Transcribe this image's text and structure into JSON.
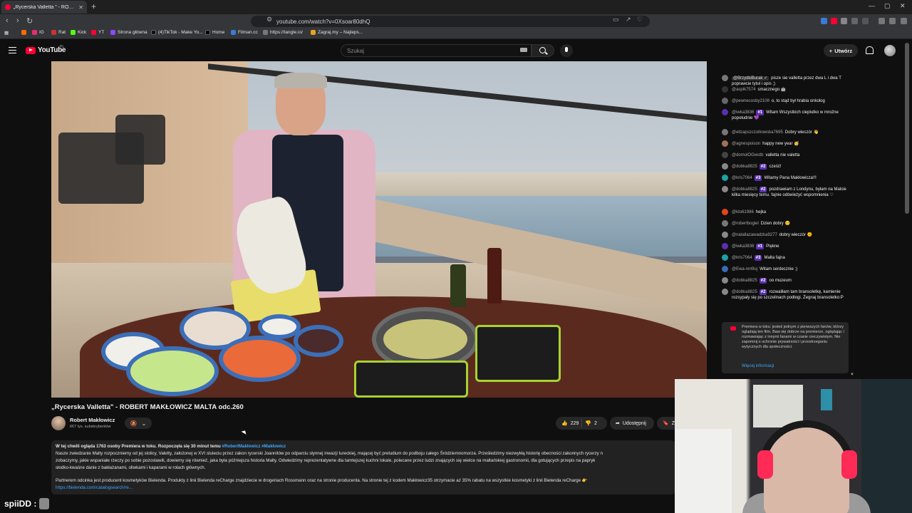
{
  "browser": {
    "tab_title": "„Rycerska Valletta \" - ROBERT",
    "url": "youtube.com/watch?v=0Xsoar80dhQ",
    "new_tab_symbol": "+",
    "tab_close_symbol": "✕",
    "bookmarks": [
      {
        "label": "IG",
        "color": "#e1306c"
      },
      {
        "label": "Rat",
        "color": "#cc3333"
      },
      {
        "label": "Kick",
        "color": "#53fc18"
      },
      {
        "label": "YT",
        "color": "#ff0033"
      },
      {
        "label": "Strona główna",
        "color": "#9146ff"
      },
      {
        "label": "(4)TikTok - Make Yo...",
        "color": "#111111"
      },
      {
        "label": "Home",
        "color": "#000000"
      },
      {
        "label": "Filman.cc",
        "color": "#3a7bd5"
      },
      {
        "label": "https://tangle.io/",
        "color": "#777777"
      },
      {
        "label": "Zagraj.my – Najleps...",
        "color": "#e8a320"
      }
    ]
  },
  "masthead": {
    "logo": "YouTube",
    "region": "PL",
    "search_placeholder": "Szukaj",
    "create_label": "Utwórz",
    "create_icon": "+"
  },
  "video": {
    "title": "„Rycerska Valletta\" - ROBERT MAKŁOWICZ MALTA odc.260",
    "channel": "Robert Makłowicz",
    "subscribers": "667 tys. subskrybentów",
    "notify_icon": "bell-slash-icon",
    "likes": "229",
    "dislikes": "2",
    "share_label": "Udostępnij",
    "save_label": "Za"
  },
  "description": {
    "meta": "W tej chwili ogląda 1763 osoby  Premiera w toku. Rozpoczęła się 30 minut temu",
    "tags": "#RobertMakłowicz #Makłowicz",
    "line1": "Nasze zwiedzanie Malty rozpoczniemy od jej stolicy, Valetty, założonej w XVI stuleciu przez zakon rycerski Joannitów po odparciu słynnej inwazji tureckiej, mającej być preludium do podboju całego Śródziemnomorza. Prześledzimy niezwykłą historię obecności zakonnych rycerzy n",
    "line2": "zobaczymy, jakie wspaniałe rzeczy po sobie pozostawili, dowiemy się również, jaka była późniejsza historia Malty. Odwiedzimy reprezentatywne dla tamtejszej kuchni lokale, polecane przez ludzi znających się wielce na maltańskiej gastronomii, dla gotujących przepis na papryk",
    "line3": "słodko-kwaśne danie z bakłażanami, oliwkami i kaparami w rolach głównych.",
    "line4": "Partnerem odcinka jest producent kosmetyków Bielenda. Produkty z linii Bielenda reCharge znajdziecie w drogeriach Rossmann oraz na stronie producenta. Na stronie tej z kodem Makłowicz35 otrzymacie aż 35% rabatu na wszystkie kosmetyki z linii Bielenda reCharge 👉",
    "link": "https://bielenda.com/catalogsearch/re..."
  },
  "chat": {
    "messages": [
      {
        "author": "@BrzydkiBurak ✓",
        "badge": "",
        "text": "pisze sie valletta przez dwa L i dwa T poprawcie tytuł i opis ;)",
        "color": "#777777",
        "highlight": true
      },
      {
        "author": "@aspik7574",
        "badge": "",
        "text": "smacznego 🤖",
        "color": "#333333",
        "highlight": false
      },
      {
        "author": "@pewnecosby2108",
        "badge": "",
        "text": "o, to stąd był hrabia onkolog",
        "color": "#666666",
        "highlight": false
      },
      {
        "author": "@iwka3836",
        "badge": "#1",
        "text": "Witam Wszystkich cieplutko w mroźne popołudnie 💜",
        "color": "#5a2fb0",
        "highlight": false
      },
      {
        "author": "@elizapszczolkowska7695",
        "badge": "",
        "text": "Dobry wieczór 👋",
        "color": "#777777",
        "highlight": false
      },
      {
        "author": "@agnespoison",
        "badge": "",
        "text": "happy new year 🥳",
        "color": "#a0705a",
        "highlight": false
      },
      {
        "author": "@domolOGwotb",
        "badge": "",
        "text": "valletta nie valetta",
        "color": "#444444",
        "highlight": false
      },
      {
        "author": "@dobka8825",
        "badge": "#2",
        "text": "cześć!",
        "color": "#888888",
        "highlight": false
      },
      {
        "author": "@kris7064",
        "badge": "#3",
        "text": "Witamy Pana Makłowicza!!!",
        "color": "#1aa3a3",
        "highlight": false
      },
      {
        "author": "@dobka8825",
        "badge": "#2",
        "text": "pozdrawiam z Londynu, byłam na Malcie kilka miesięcy temu. fajnie odświeżyć wspomnienia ♡",
        "color": "#888888",
        "highlight": false
      },
      {
        "author": "@kto61986",
        "badge": "",
        "text": "hejka",
        "color": "#e0451f",
        "highlight": false
      },
      {
        "author": "@robertbogiel",
        "badge": "",
        "text": "Dzien dobry 😊",
        "color": "#777777",
        "highlight": false
      },
      {
        "author": "@natallazawadzka9277",
        "badge": "",
        "text": "dobry wieczór 🌞",
        "color": "#888888",
        "highlight": false
      },
      {
        "author": "@iwka3836",
        "badge": "#1",
        "text": "Piękne",
        "color": "#5a2fb0",
        "highlight": false
      },
      {
        "author": "@kris7064",
        "badge": "#3",
        "text": "Malta fajna",
        "color": "#1aa3a3",
        "highlight": false
      },
      {
        "author": "@Ewa-nm9uj",
        "badge": "",
        "text": "Witam serdecznie :)",
        "color": "#3a6ab5",
        "highlight": false
      },
      {
        "author": "@dobka8825",
        "badge": "#2",
        "text": "oo muzeum",
        "color": "#888888",
        "highlight": false
      },
      {
        "author": "@dobka8825",
        "badge": "#2",
        "text": "rozwaliłam tam bransoletkę, kamienie rozsypały się po szczelinach podłogi. Żegnaj bransoletko:P",
        "color": "#888888",
        "highlight": false
      }
    ],
    "premiere_text": "Premiera w toku: jesteś jednym z pierwszych fanów, którzy oglądają ten film. Baw się dobrze na premierze, oglądając i rozmawiając z innymi fanami w czasie rzeczywistym. Nie zapomnij o ochronie prywatności i przestrzeganiu wytycznych dla społeczności.",
    "premiere_more": "Więcej informacji"
  },
  "overlay": {
    "streamer": "spiiDD :"
  }
}
